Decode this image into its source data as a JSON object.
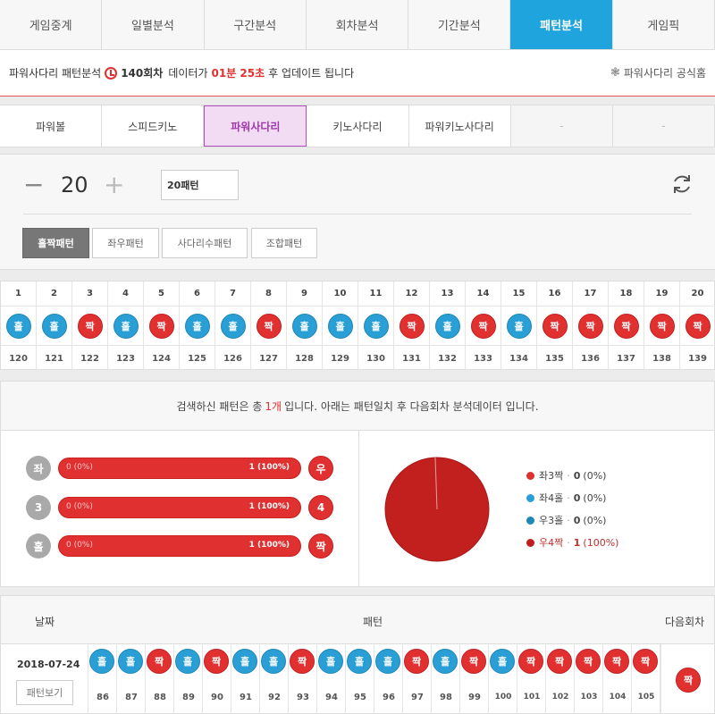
{
  "topnav": {
    "tabs": [
      "게임중계",
      "일별분석",
      "구간분석",
      "회차분석",
      "기간분석",
      "패턴분석",
      "게임픽"
    ],
    "active_index": 5,
    "active_color": "#1fa4de"
  },
  "infobar": {
    "title": "파워사다리 패턴분석",
    "round": "140회차",
    "middle_text": "데이터가",
    "timer": "01분 25초",
    "suffix": "후 업데이트 됩니다",
    "official_link": "파워사다리 공식홈"
  },
  "gametabs": {
    "tabs": [
      "파워볼",
      "스피드키노",
      "파워사다리",
      "키노사다리",
      "파워키노사다리",
      "-",
      "-"
    ],
    "active_index": 2
  },
  "controls": {
    "minus": "−",
    "count": "20",
    "plus": "+",
    "select_value": "20패턴",
    "pattern_tabs": [
      "홀짝패턴",
      "좌우패턴",
      "사다리수패턴",
      "조합패턴"
    ],
    "active_pattern": 0
  },
  "grid": {
    "positions": [
      "1",
      "2",
      "3",
      "4",
      "5",
      "6",
      "7",
      "8",
      "9",
      "10",
      "11",
      "12",
      "13",
      "14",
      "15",
      "16",
      "17",
      "18",
      "19",
      "20"
    ],
    "results": [
      "홀",
      "홀",
      "짝",
      "홀",
      "짝",
      "홀",
      "홀",
      "짝",
      "홀",
      "홀",
      "홀",
      "짝",
      "홀",
      "짝",
      "홀",
      "짝",
      "짝",
      "짝",
      "짝",
      "짝"
    ],
    "rounds": [
      "120",
      "121",
      "122",
      "123",
      "124",
      "125",
      "126",
      "127",
      "128",
      "129",
      "130",
      "131",
      "132",
      "133",
      "134",
      "135",
      "136",
      "137",
      "138",
      "139"
    ]
  },
  "result_summary": {
    "prefix": "검색하신 패턴은 총",
    "count": "1개",
    "suffix": "입니다. 아래는 패턴일치 후 다음회차 분석데이터 입니다."
  },
  "stats": {
    "rows": [
      {
        "left_label": "좌",
        "left_value": "0 (0%)",
        "right_value": "1 (100%)",
        "right_label": "우",
        "right_fraction": 1.0
      },
      {
        "left_label": "3",
        "left_value": "0 (0%)",
        "right_value": "1 (100%)",
        "right_label": "4",
        "right_fraction": 1.0
      },
      {
        "left_label": "홀",
        "left_value": "0 (0%)",
        "right_value": "1 (100%)",
        "right_label": "짝",
        "right_fraction": 1.0
      }
    ],
    "legend": [
      {
        "label": "좌3짝",
        "value": "0",
        "pct": "(0%)",
        "color": "#e03030"
      },
      {
        "label": "좌4홀",
        "value": "0",
        "pct": "(0%)",
        "color": "#2a9fd6"
      },
      {
        "label": "우3홀",
        "value": "0",
        "pct": "(0%)",
        "color": "#1f86b7"
      },
      {
        "label": "우4짝",
        "value": "1",
        "pct": "(100%)",
        "color": "#c01e1e"
      }
    ],
    "pie_fraction": 1.0,
    "pie_color": "#c21f1f"
  },
  "history": {
    "headers": {
      "date": "날짜",
      "pattern": "패턴",
      "next": "다음회차"
    },
    "date": "2018-07-24",
    "view_button": "패턴보기",
    "results": [
      "홀",
      "홀",
      "짝",
      "홀",
      "짝",
      "홀",
      "홀",
      "짝",
      "홀",
      "홀",
      "홀",
      "짝",
      "홀",
      "짝",
      "홀",
      "짝",
      "짝",
      "짝",
      "짝",
      "짝"
    ],
    "rounds": [
      "86",
      "87",
      "88",
      "89",
      "90",
      "91",
      "92",
      "93",
      "94",
      "95",
      "96",
      "97",
      "98",
      "99",
      "100",
      "101",
      "102",
      "103",
      "104",
      "105"
    ],
    "next_result": "짝"
  }
}
